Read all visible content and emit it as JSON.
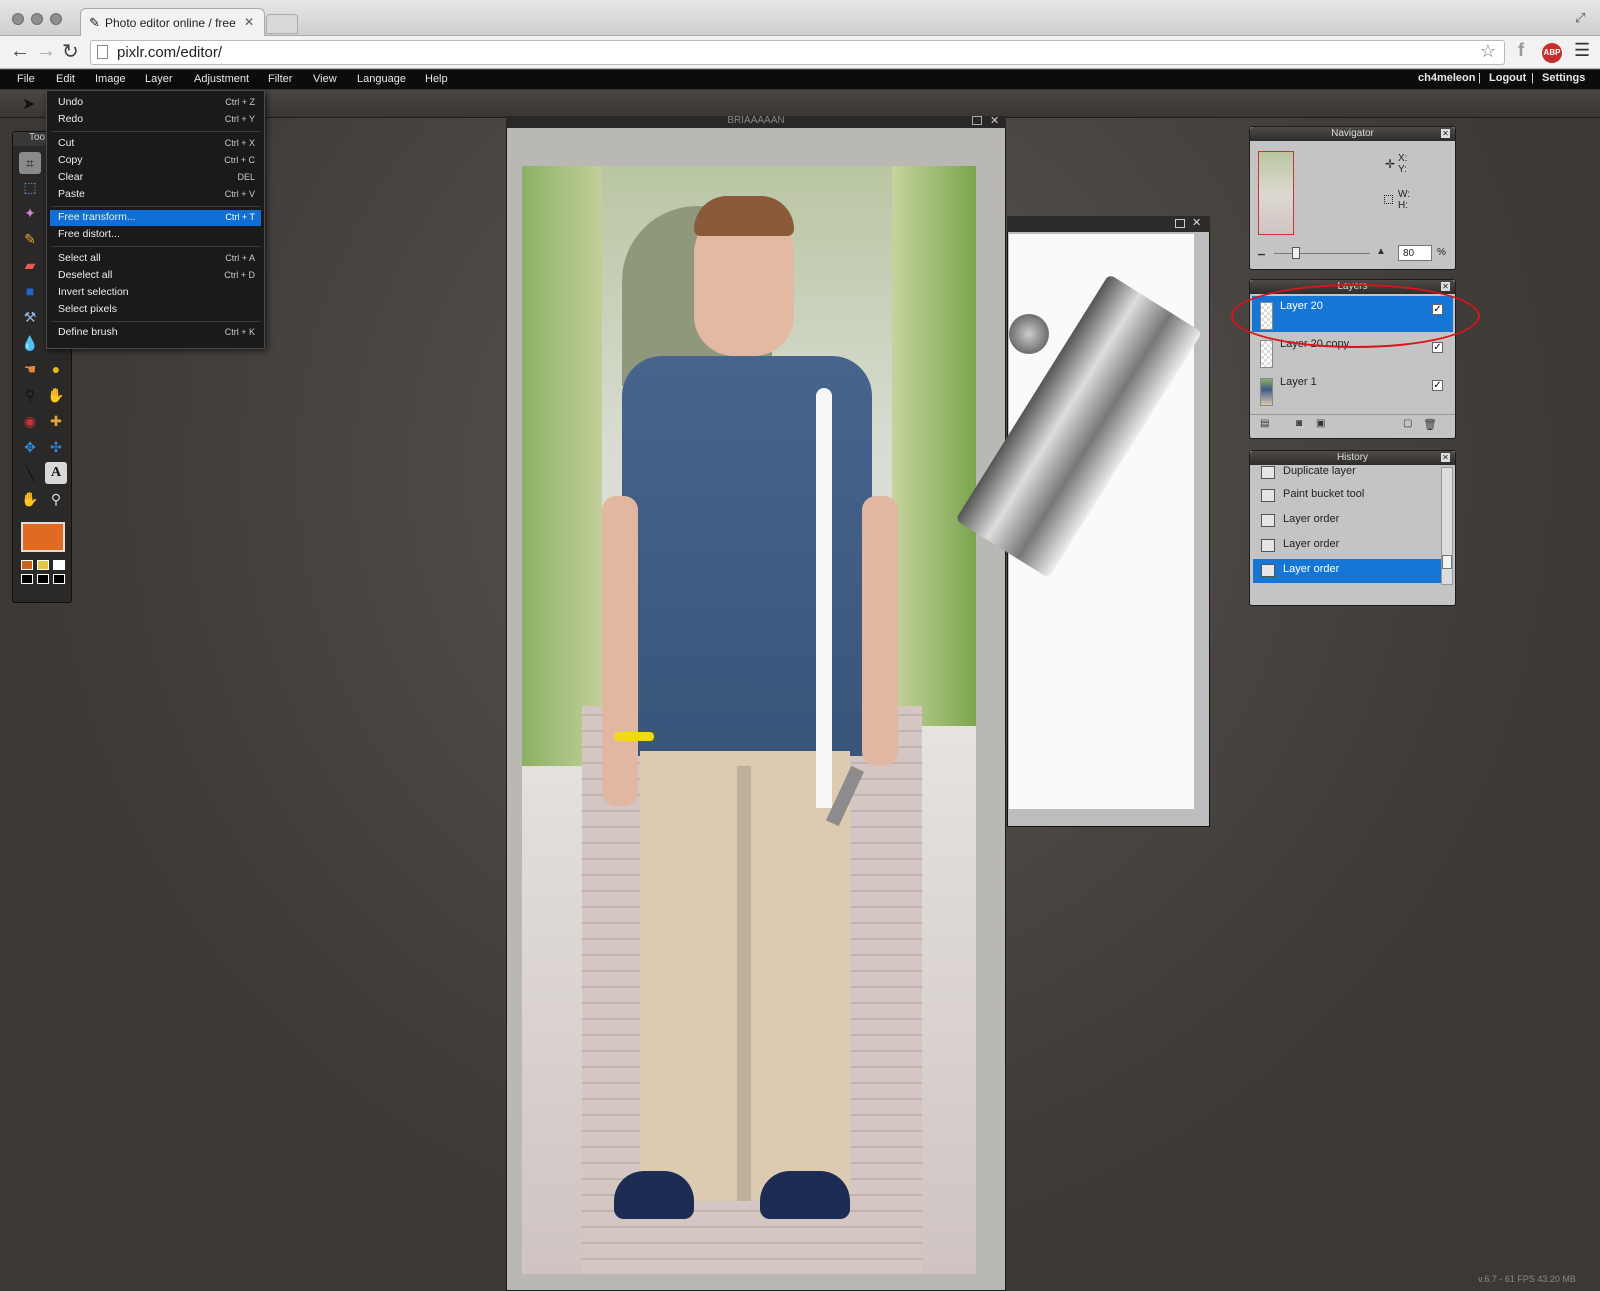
{
  "browser": {
    "tab_title": "Photo editor online / free",
    "url": "pixlr.com/editor/",
    "abp_label": "ABP"
  },
  "menubar": {
    "items": [
      "File",
      "Edit",
      "Image",
      "Layer",
      "Adjustment",
      "Filter",
      "View",
      "Language",
      "Help"
    ],
    "user": "ch4meleon",
    "logout": "Logout",
    "settings": "Settings",
    "divider": "|"
  },
  "edit_menu": {
    "items": [
      {
        "label": "Undo",
        "shortcut": "Ctrl + Z"
      },
      {
        "label": "Redo",
        "shortcut": "Ctrl + Y"
      },
      {
        "label": "Cut",
        "shortcut": "Ctrl + X"
      },
      {
        "label": "Copy",
        "shortcut": "Ctrl + C"
      },
      {
        "label": "Clear",
        "shortcut": "DEL"
      },
      {
        "label": "Paste",
        "shortcut": "Ctrl + V"
      },
      {
        "label": "Free transform...",
        "shortcut": "Ctrl + T"
      },
      {
        "label": "Free distort...",
        "shortcut": ""
      },
      {
        "label": "Select all",
        "shortcut": "Ctrl + A"
      },
      {
        "label": "Deselect all",
        "shortcut": "Ctrl + D"
      },
      {
        "label": "Invert selection",
        "shortcut": ""
      },
      {
        "label": "Select pixels",
        "shortcut": ""
      },
      {
        "label": "Define brush",
        "shortcut": "Ctrl + K"
      }
    ],
    "selected_index": 6
  },
  "tools_panel": {
    "title": "Too",
    "primary_color": "#e06a22",
    "swatches": [
      "#c8661f",
      "#e3c73c",
      "#ffffff",
      "#000000",
      "#000000",
      "#000000"
    ]
  },
  "document": {
    "title": "BRIAAAAAN"
  },
  "navigator": {
    "title": "Navigator",
    "x_label": "X:",
    "y_label": "Y:",
    "w_label": "W:",
    "h_label": "H:",
    "zoom": "80",
    "zoom_unit": "%"
  },
  "layers": {
    "title": "Layers",
    "items": [
      {
        "name": "Layer 20",
        "visible": true,
        "selected": true
      },
      {
        "name": "Layer 20 copy",
        "visible": true,
        "selected": false
      },
      {
        "name": "Layer 1",
        "visible": true,
        "selected": false
      }
    ],
    "check_mark": "✓"
  },
  "history": {
    "title": "History",
    "items": [
      {
        "label": "Duplicate layer",
        "selected": false
      },
      {
        "label": "Paint bucket tool",
        "selected": false
      },
      {
        "label": "Layer order",
        "selected": false
      },
      {
        "label": "Layer order",
        "selected": false
      },
      {
        "label": "Layer order",
        "selected": true
      }
    ]
  },
  "status": {
    "text": "v.6.7 - 61 FPS 43.20 MB"
  },
  "colors": {
    "selection_blue": "#1676d6",
    "annotation_red": "#d9141a"
  }
}
